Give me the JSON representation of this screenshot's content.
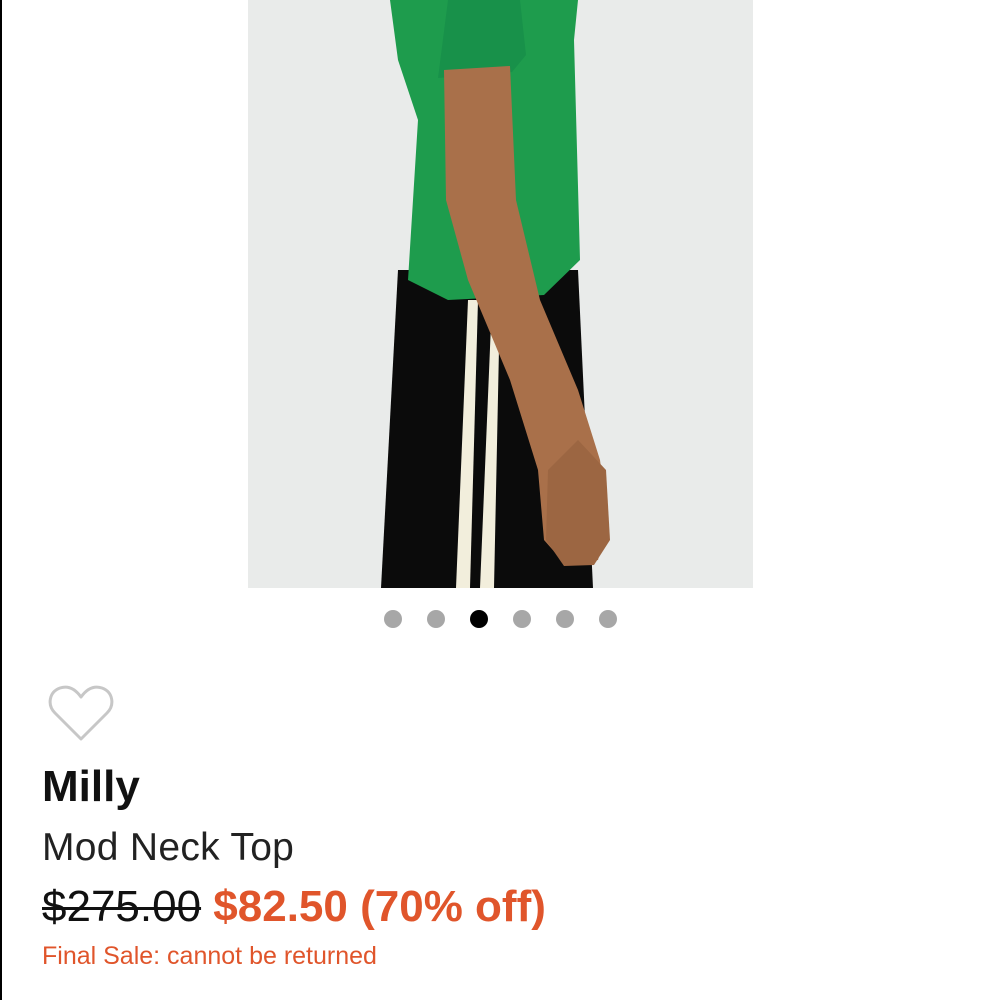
{
  "product": {
    "brand": "Milly",
    "title": "Mod Neck Top",
    "original_price": "$275.00",
    "sale_price": "$82.50",
    "discount": "(70% off)",
    "final_sale_note": "Final Sale: cannot be returned"
  },
  "carousel": {
    "total": 6,
    "active_index": 2
  },
  "colors": {
    "accent": "#e0552b",
    "dot_inactive": "#a7a7a7",
    "dot_active": "#000000",
    "heart_outline": "#c7c7c7"
  },
  "icons": {
    "favorite": "heart-outline-icon"
  }
}
